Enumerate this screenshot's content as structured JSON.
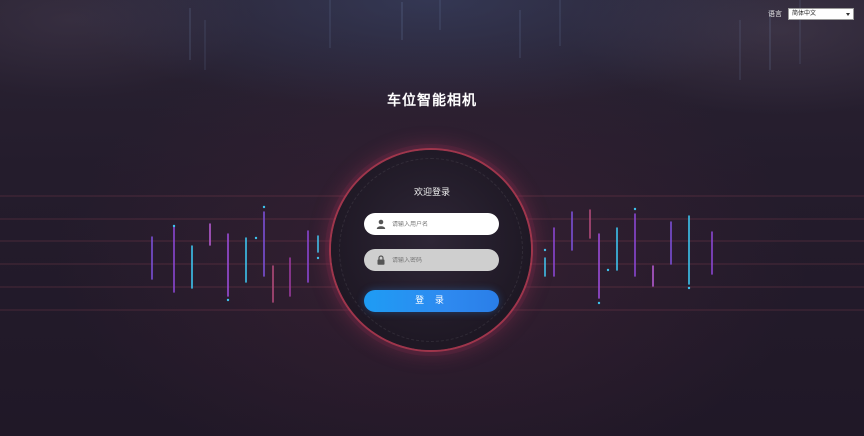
{
  "header": {
    "language_label": "语言",
    "language_selected": "简体中文"
  },
  "app": {
    "title": "车位智能相机"
  },
  "login": {
    "welcome": "欢迎登录",
    "username_placeholder": "请输入用户名",
    "password_placeholder": "请输入密码",
    "submit_label": "登 录"
  },
  "colors": {
    "accent_blue": "#1e9cf4",
    "ring_red": "#dc465a",
    "background": "#221b2a"
  },
  "icons": {
    "username": "user-icon",
    "password": "lock-icon",
    "select": "chevron-down-icon"
  }
}
